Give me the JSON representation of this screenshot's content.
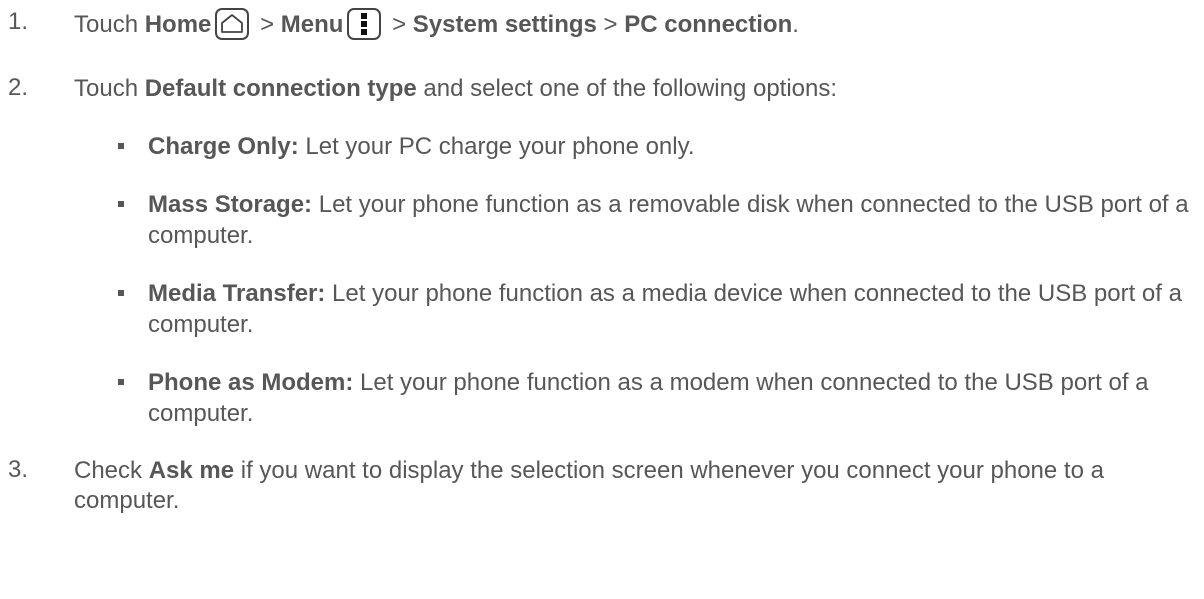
{
  "steps": [
    {
      "number": "1.",
      "prefix": "Touch ",
      "home_label": "Home",
      "sep1": " > ",
      "menu_label": "Menu",
      "sep2": " > ",
      "system_label": "System settings",
      "sep3": " > ",
      "pc_label": "PC connection",
      "suffix": "."
    },
    {
      "number": "2.",
      "prefix": "Touch ",
      "bold": "Default connection type",
      "suffix": " and select one of the following options:"
    },
    {
      "number": "3.",
      "prefix": "Check ",
      "bold": "Ask me",
      "suffix": " if you want to display the selection screen whenever you connect your phone to a computer."
    }
  ],
  "options": [
    {
      "term": "Charge Only:",
      "desc": " Let your PC charge your phone only."
    },
    {
      "term": "Mass Storage:",
      "desc": " Let your phone function as a removable disk when connected to the USB port of a computer."
    },
    {
      "term": "Media Transfer:",
      "desc": " Let your phone function as a media device when connected to the USB port of a computer."
    },
    {
      "term": "Phone as Modem:",
      "desc": " Let your phone function as a modem when connected to the USB port of a computer."
    }
  ],
  "icons": {
    "home": "home-icon",
    "menu": "menu-icon"
  },
  "colors": {
    "text": "#575757",
    "icon_border": "#444444"
  }
}
